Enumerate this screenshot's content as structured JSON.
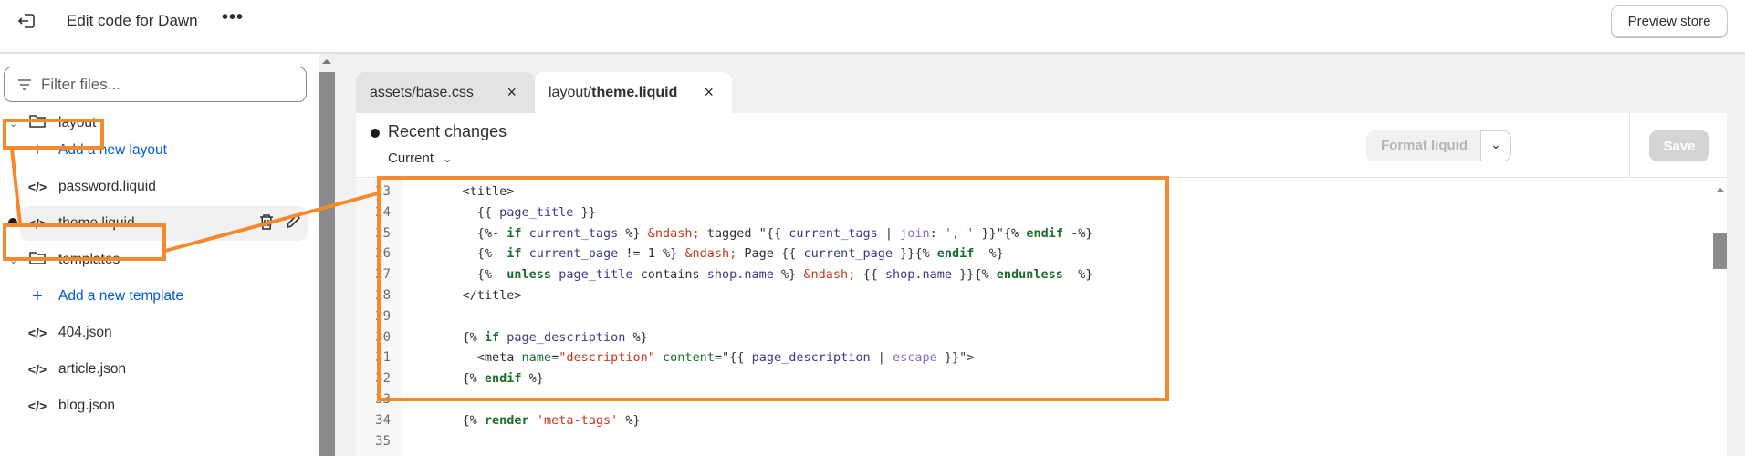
{
  "header": {
    "title": "Edit code for Dawn",
    "more": "•••",
    "preview_label": "Preview store"
  },
  "sidebar": {
    "filter_placeholder": "Filter files...",
    "items": [
      {
        "type": "folder",
        "label": "layout"
      },
      {
        "type": "add",
        "label": "Add a new layout"
      },
      {
        "type": "file",
        "label": "password.liquid"
      },
      {
        "type": "file",
        "label": "theme.liquid",
        "selected": true,
        "modified": true
      },
      {
        "type": "folder",
        "label": "templates"
      },
      {
        "type": "add",
        "label": "Add a new template"
      },
      {
        "type": "file",
        "label": "404.json"
      },
      {
        "type": "file",
        "label": "article.json"
      },
      {
        "type": "file",
        "label": "blog.json"
      }
    ]
  },
  "tabs": [
    {
      "prefix": "assets/base.css",
      "bold": "",
      "active": false,
      "close": "×"
    },
    {
      "prefix": "layout/",
      "bold": "theme.liquid",
      "active": true,
      "close": "×"
    }
  ],
  "editor": {
    "recent_changes": "Recent changes",
    "version": "Current",
    "format_label": "Format liquid",
    "save_label": "Save",
    "lines": [
      {
        "n": "23",
        "tokens": [
          [
            "    <title>",
            "t"
          ]
        ]
      },
      {
        "n": "24",
        "tokens": [
          [
            "      {{ ",
            "t"
          ],
          [
            "page_title",
            "v"
          ],
          [
            " }}",
            "t"
          ]
        ]
      },
      {
        "n": "25",
        "tokens": [
          [
            "      {%- ",
            "t"
          ],
          [
            "if",
            "k"
          ],
          [
            " current_tags",
            "v"
          ],
          [
            " %} ",
            "t"
          ],
          [
            "&ndash;",
            "s"
          ],
          [
            " tagged \"{{ ",
            "t"
          ],
          [
            "current_tags",
            "v"
          ],
          [
            " | ",
            "t"
          ],
          [
            "join",
            "f"
          ],
          [
            ": ",
            "t"
          ],
          [
            "', '",
            "s"
          ],
          [
            " }}\"{% ",
            "t"
          ],
          [
            "endif",
            "k"
          ],
          [
            " -%}",
            "t"
          ]
        ]
      },
      {
        "n": "26",
        "tokens": [
          [
            "      {%- ",
            "t"
          ],
          [
            "if",
            "k"
          ],
          [
            " current_page",
            "v"
          ],
          [
            " != 1 %} ",
            "t"
          ],
          [
            "&ndash;",
            "s"
          ],
          [
            " Page {{ ",
            "t"
          ],
          [
            "current_page",
            "v"
          ],
          [
            " }}{% ",
            "t"
          ],
          [
            "endif",
            "k"
          ],
          [
            " -%}",
            "t"
          ]
        ]
      },
      {
        "n": "27",
        "tokens": [
          [
            "      {%- ",
            "t"
          ],
          [
            "unless",
            "k"
          ],
          [
            " page_title",
            "v"
          ],
          [
            " contains ",
            "t"
          ],
          [
            "shop.name",
            "v"
          ],
          [
            " %} ",
            "t"
          ],
          [
            "&ndash;",
            "s"
          ],
          [
            " {{ ",
            "t"
          ],
          [
            "shop.name",
            "v"
          ],
          [
            " }}{% ",
            "t"
          ],
          [
            "endunless",
            "k"
          ],
          [
            " -%}",
            "t"
          ]
        ]
      },
      {
        "n": "28",
        "tokens": [
          [
            "    </title>",
            "t"
          ]
        ]
      },
      {
        "n": "29",
        "tokens": []
      },
      {
        "n": "30",
        "tokens": [
          [
            "    {% ",
            "t"
          ],
          [
            "if",
            "k"
          ],
          [
            " page_description",
            "v"
          ],
          [
            " %}",
            "t"
          ]
        ]
      },
      {
        "n": "31",
        "tokens": [
          [
            "      <meta ",
            "t"
          ],
          [
            "name",
            "a"
          ],
          [
            "=",
            "t"
          ],
          [
            "\"description\"",
            "s"
          ],
          [
            " ",
            "t"
          ],
          [
            "content",
            "a"
          ],
          [
            "=\"{{ ",
            "t"
          ],
          [
            "page_description",
            "v"
          ],
          [
            " | ",
            "t"
          ],
          [
            "escape",
            "f"
          ],
          [
            " }}\">",
            "t"
          ]
        ]
      },
      {
        "n": "32",
        "tokens": [
          [
            "    {% ",
            "t"
          ],
          [
            "endif",
            "k"
          ],
          [
            " %}",
            "t"
          ]
        ]
      },
      {
        "n": "33",
        "tokens": []
      },
      {
        "n": "34",
        "tokens": [
          [
            "    {% ",
            "t"
          ],
          [
            "render",
            "k"
          ],
          [
            " ",
            "t"
          ],
          [
            "'meta-tags'",
            "s"
          ],
          [
            " %}",
            "t"
          ]
        ]
      },
      {
        "n": "35",
        "tokens": []
      }
    ]
  },
  "colors": {
    "annotation": "#f58a2c",
    "link": "#005bd3",
    "keyword": "#1b6e2e",
    "variable": "#3d3a8a",
    "string": "#c03a25",
    "filter": "#8b6fc6"
  }
}
